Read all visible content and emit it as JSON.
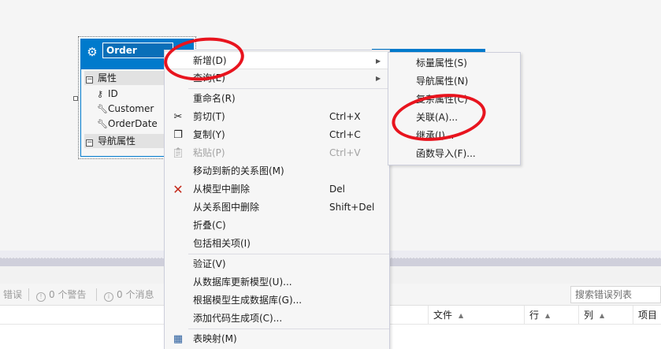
{
  "entity": {
    "name": "Order",
    "properties_section": "属性",
    "properties": [
      "ID",
      "Customer",
      "OrderDate"
    ],
    "nav_section": "导航属性"
  },
  "context_menu": {
    "items": [
      {
        "label": "新增(D)",
        "shortcut": "",
        "submenu": true
      },
      {
        "label": "查询(E)",
        "shortcut": "",
        "submenu": true
      },
      {
        "label": "重命名(R)",
        "shortcut": ""
      },
      {
        "label": "剪切(T)",
        "shortcut": "Ctrl+X",
        "icon": "scissors-icon"
      },
      {
        "label": "复制(Y)",
        "shortcut": "Ctrl+C",
        "icon": "copy-icon"
      },
      {
        "label": "粘贴(P)",
        "shortcut": "Ctrl+V",
        "icon": "paste-icon",
        "disabled": true
      },
      {
        "label": "移动到新的关系图(M)",
        "shortcut": ""
      },
      {
        "label": "从模型中删除",
        "shortcut": "Del",
        "icon": "delete-x-icon"
      },
      {
        "label": "从关系图中删除",
        "shortcut": "Shift+Del"
      },
      {
        "label": "折叠(C)",
        "shortcut": ""
      },
      {
        "label": "包括相关项(I)",
        "shortcut": ""
      },
      {
        "label": "验证(V)",
        "shortcut": ""
      },
      {
        "label": "从数据库更新模型(U)...",
        "shortcut": ""
      },
      {
        "label": "根据模型生成数据库(G)...",
        "shortcut": ""
      },
      {
        "label": "添加代码生成项(C)...",
        "shortcut": ""
      },
      {
        "label": "表映射(M)",
        "shortcut": "",
        "icon": "table-mapping-icon"
      }
    ]
  },
  "submenu": {
    "items": [
      "标量属性(S)",
      "导航属性(N)",
      "复杂属性(C)",
      "关联(A)...",
      "继承(I)...",
      "函数导入(F)..."
    ]
  },
  "error_list": {
    "errors": "错误",
    "warnings": "0 个警告",
    "messages": "0 个消息",
    "search_placeholder": "搜索错误列表",
    "columns": [
      "文件",
      "行",
      "列",
      "项目"
    ]
  },
  "colors": {
    "accent": "#007acc",
    "annotation": "#e8141e",
    "delete": "#c42b1c"
  }
}
